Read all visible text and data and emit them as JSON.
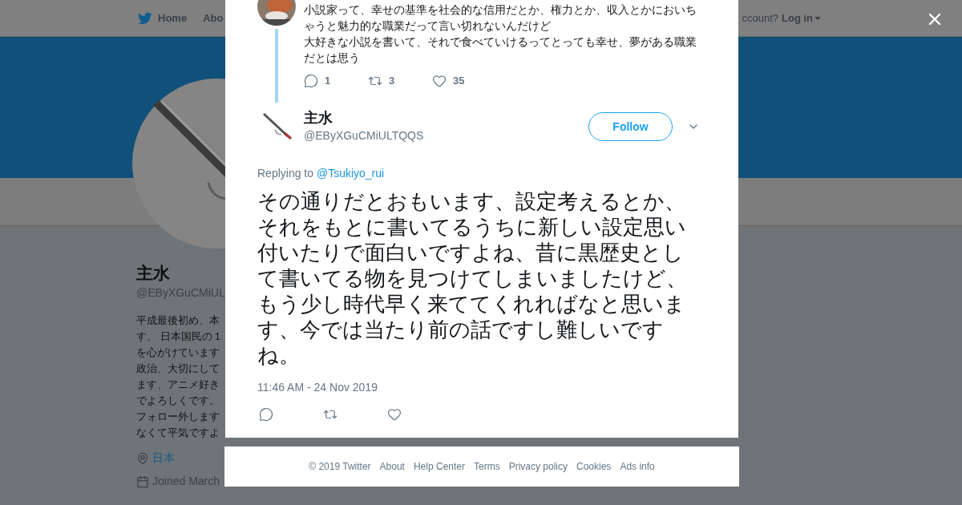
{
  "nav": {
    "items": [
      {
        "label": "Home"
      },
      {
        "label": "Abo"
      }
    ],
    "account_prompt": "ccount?",
    "login": "Log in"
  },
  "profile": {
    "name": "主水",
    "handle": "@EByXGuCMiUL",
    "bio_lines": [
      "平成最後初め、本",
      "す、 日本国民の１",
      "を心がけています",
      "政治、大切にして",
      "ます、アニメ好き",
      "でよろしくです。",
      "フォロー外します",
      "なくて平気ですよ"
    ],
    "location": "日本",
    "joined": "Joined March"
  },
  "parent_tweet": {
    "paragraphs": [
      "小説家って、幸せの基準を社会的な信用だとか、権力とか、収入とかにおいちゃうと魅力的な職業だって言い切れないんだけど",
      "大好きな小説を書いて、それで食べていけるってとっても幸せ、夢がある職業だとは思う"
    ],
    "replies": "1",
    "retweets": "3",
    "likes": "35"
  },
  "tweet": {
    "name": "主水",
    "handle": "@EByXGuCMiULTQQS",
    "follow": "Follow",
    "replying_label": "Replying to",
    "reply_to": "@Tsukiyo_rui",
    "text": "その通りだとおもいます、設定考えるとか、それをもとに書いてるうちに新しい設定思い付いたりで面白いですよね、昔に黒歴史として書いてる物を見つけてしまいましたけど、もう少し時代早く来ててくれればなと思います、今では当たり前の話ですし難しいですね。",
    "time": "11:46 AM - 24 Nov 2019"
  },
  "footer": [
    "© 2019 Twitter",
    "About",
    "Help Center",
    "Terms",
    "Privacy policy",
    "Cookies",
    "Ads info"
  ]
}
